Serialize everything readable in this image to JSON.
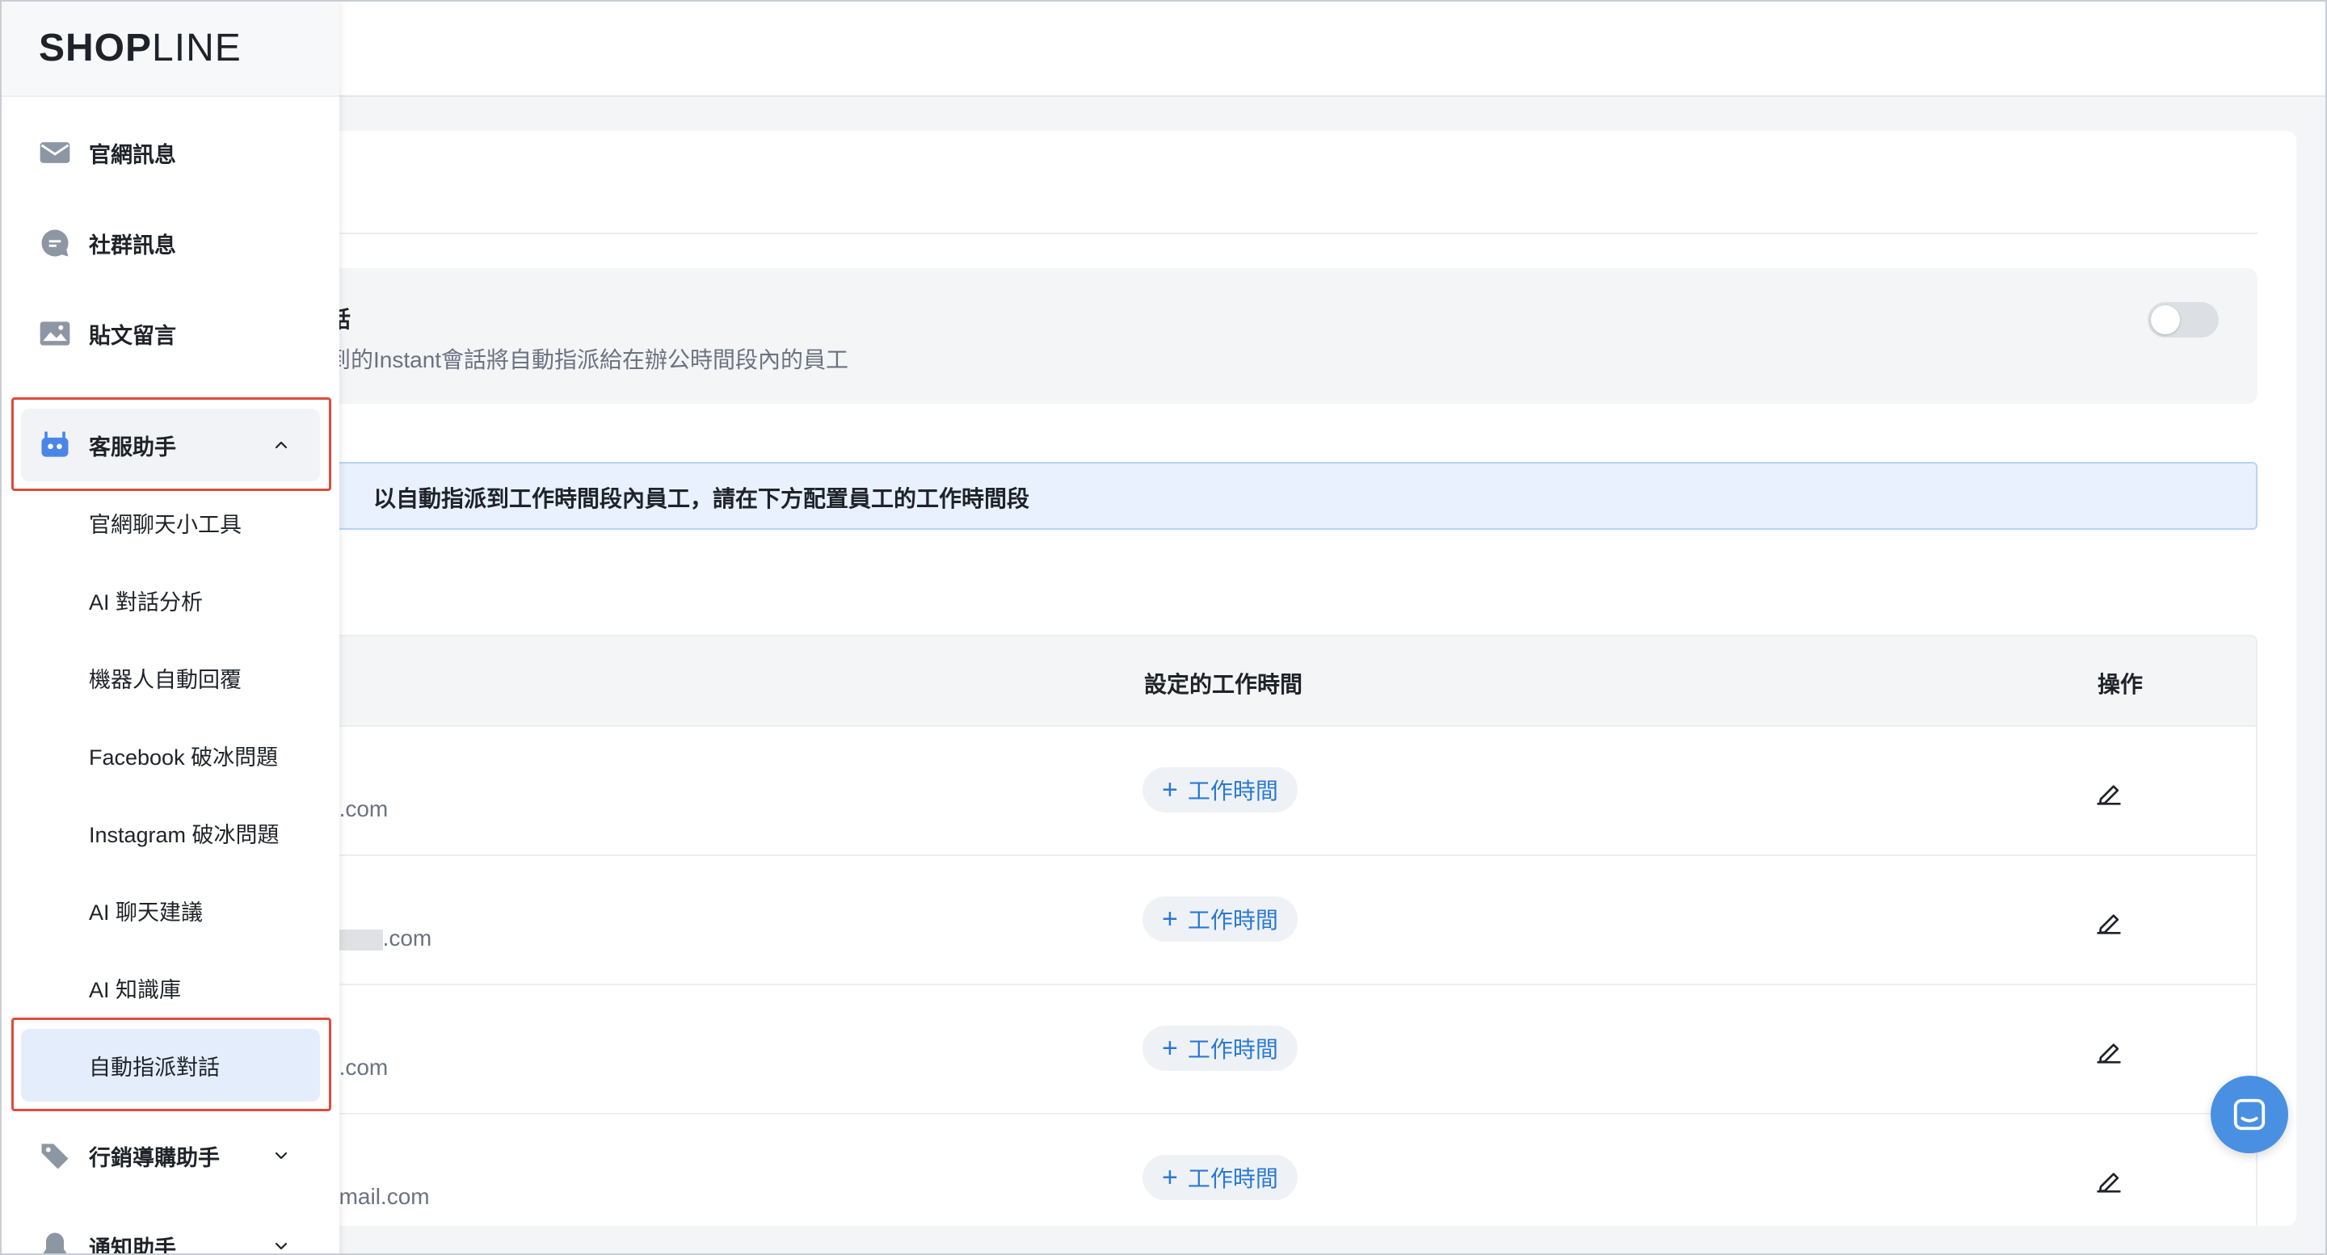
{
  "brand": {
    "logo_bold": "SHOP",
    "logo_light": "LINE"
  },
  "colors": {
    "accent": "#2a78d6",
    "highlight_border": "#e04b3a",
    "notice_bg": "#e8f1fd",
    "fab": "#4a90e2"
  },
  "sidebar": {
    "items": [
      {
        "label": "官網訊息",
        "icon": "envelope-icon"
      },
      {
        "label": "社群訊息",
        "icon": "chat-bubble-icon"
      },
      {
        "label": "貼文留言",
        "icon": "image-icon"
      },
      {
        "label": "客服助手",
        "icon": "robot-icon",
        "expanded": true
      }
    ],
    "sub_items": [
      {
        "label": "官網聊天小工具"
      },
      {
        "label": "AI 對話分析"
      },
      {
        "label": "機器人自動回覆"
      },
      {
        "label": "Facebook 破冰問題"
      },
      {
        "label": "Instagram 破冰問題"
      },
      {
        "label": "AI 聊天建議"
      },
      {
        "label": "AI 知識庫"
      },
      {
        "label": "自動指派對話",
        "active": true
      }
    ],
    "bottom_items": [
      {
        "label": "行銷導購助手",
        "icon": "tag-icon",
        "expanded": false
      },
      {
        "label": "通知助手",
        "icon": "bell-icon",
        "expanded": false
      }
    ]
  },
  "setting": {
    "title": "話",
    "description": "到的Instant會話將自動指派給在辦公時間段內的員工",
    "toggle_on": false
  },
  "notice": {
    "text": "以自動指派到工作時間段內員工，請在下方配置員工的工作時間段"
  },
  "table": {
    "columns": {
      "hours": "設定的工作時間",
      "actions": "操作"
    },
    "rows": [
      {
        "email_prefix": "",
        "email_suffix": "e.com",
        "masked": false,
        "button": "工作時間"
      },
      {
        "email_prefix": "o",
        "email_suffix": ".com",
        "masked": true,
        "button": "工作時間"
      },
      {
        "email_prefix": "",
        "email_suffix": "e.com",
        "masked": false,
        "button": "工作時間"
      },
      {
        "email_prefix": "",
        "email_suffix": "gmail.com",
        "masked": false,
        "button": "工作時間"
      }
    ]
  }
}
